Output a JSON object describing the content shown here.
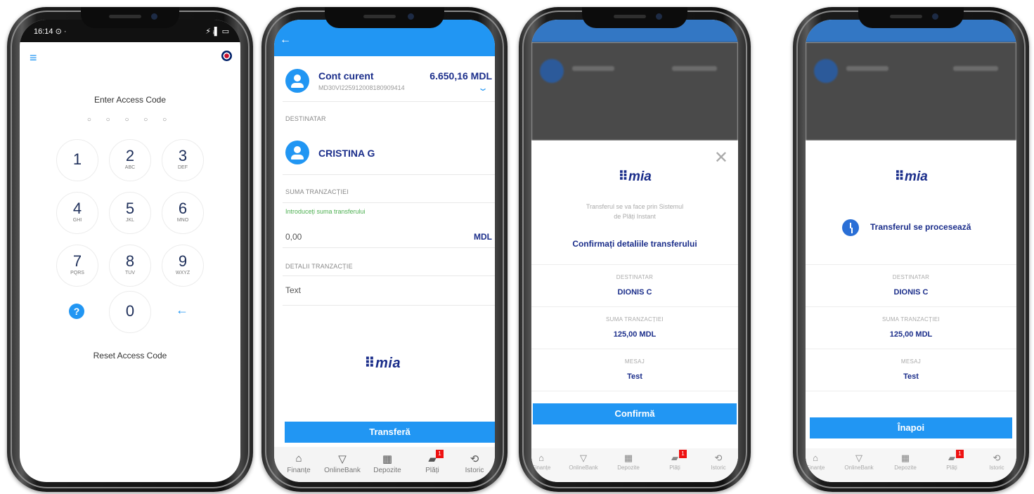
{
  "colors": {
    "primary": "#2196f3",
    "navy": "#1a2d8a",
    "hint_green": "#4caf50",
    "badge_red": "#ee1111"
  },
  "screen1": {
    "status_time": "16:14 ⊙ ·",
    "status_icons": "⚡ ᵢ▌ ▭",
    "menu_icon": "hamburger-icon",
    "language_icon": "uk-flag-icon",
    "title": "Enter Access Code",
    "code_dots": "○ ○ ○ ○ ○",
    "keys": [
      {
        "num": "1",
        "letters": ""
      },
      {
        "num": "2",
        "letters": "ABC"
      },
      {
        "num": "3",
        "letters": "DEF"
      },
      {
        "num": "4",
        "letters": "GHI"
      },
      {
        "num": "5",
        "letters": "JKL"
      },
      {
        "num": "6",
        "letters": "MNO"
      },
      {
        "num": "7",
        "letters": "PQRS"
      },
      {
        "num": "8",
        "letters": "TUV"
      },
      {
        "num": "9",
        "letters": "WXYZ"
      },
      {
        "num": "0",
        "letters": ""
      }
    ],
    "help_icon": "?",
    "backspace_icon": "←",
    "reset": "Reset Access Code"
  },
  "screen2": {
    "back_icon": "←",
    "account_name": "Cont curent",
    "account_iban": "MD30VI225912008180909414",
    "account_balance": "6.650,16 MDL",
    "expand_icon": "⌄",
    "recipient_label": "DESTINATAR",
    "recipient_name": "CRISTINA G",
    "amount_label": "SUMA TRANZACȚIEI",
    "amount_hint": "Introduceți suma transferului",
    "amount_value": "0,00",
    "amount_currency": "MDL",
    "details_label": "DETALII TRANZACȚIE",
    "details_placeholder": "Text",
    "logo": "⠿mia",
    "transfer_button": "Transferă",
    "nav": [
      {
        "icon": "⌂",
        "label": "Finanțe"
      },
      {
        "icon": "▽",
        "label": "OnlineBank"
      },
      {
        "icon": "▦",
        "label": "Depozite"
      },
      {
        "icon": "▰",
        "label": "Plăți",
        "badge": "1"
      },
      {
        "icon": "⟲",
        "label": "Istoric"
      }
    ]
  },
  "screen3": {
    "close_icon": "✕",
    "logo": "⠿mia",
    "info_line1": "Transferul se va face prin Sistemul",
    "info_line2": "de Plăți Instant",
    "title": "Confirmați detaliile transferului",
    "recipient_label": "DESTINATAR",
    "recipient_value": "DIONIS C",
    "amount_label": "SUMA TRANZACȚIEI",
    "amount_value": "125,00 MDL",
    "message_label": "MESAJ",
    "message_value": "Test",
    "confirm_button": "Confirmă",
    "nav": [
      {
        "icon": "⌂",
        "label": "Finanțe"
      },
      {
        "icon": "▽",
        "label": "OnlineBank"
      },
      {
        "icon": "▦",
        "label": "Depozite"
      },
      {
        "icon": "▰",
        "label": "Plăți",
        "badge": "1"
      },
      {
        "icon": "⟲",
        "label": "Istoric"
      }
    ]
  },
  "screen4": {
    "logo": "⠿mia",
    "status_text": "Transferul se procesează",
    "recipient_label": "DESTINATAR",
    "recipient_value": "DIONIS C",
    "amount_label": "SUMA TRANZACȚIEI",
    "amount_value": "125,00 MDL",
    "message_label": "MESAJ",
    "message_value": "Test",
    "back_button": "Înapoi",
    "nav": [
      {
        "icon": "⌂",
        "label": "Finanțe"
      },
      {
        "icon": "▽",
        "label": "OnlineBank"
      },
      {
        "icon": "▦",
        "label": "Depozite"
      },
      {
        "icon": "▰",
        "label": "Plăți",
        "badge": "1"
      },
      {
        "icon": "⟲",
        "label": "Istoric"
      }
    ]
  }
}
